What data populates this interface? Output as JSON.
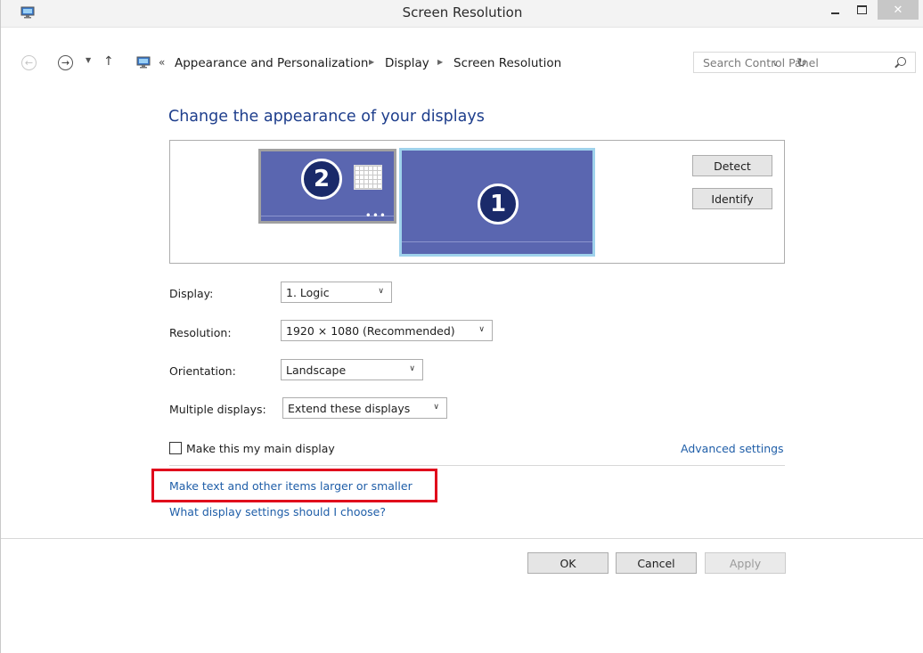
{
  "window": {
    "title": "Screen Resolution",
    "close_glyph": "✕"
  },
  "nav": {
    "back_glyph": "←",
    "forward_glyph": "→",
    "recent_glyph": "▼",
    "up_glyph": "↑",
    "breadcrumb_overflow": "«",
    "breadcrumbs": [
      "Appearance and Personalization",
      "Display",
      "Screen Resolution"
    ],
    "arrow_glyph": "▶",
    "dropdown_glyph": "∨",
    "refresh_glyph": "↻",
    "search_placeholder": "Search Control Panel"
  },
  "content": {
    "heading": "Change the appearance of your displays",
    "monitors": [
      {
        "number": "2",
        "dots": "•••"
      },
      {
        "number": "1"
      }
    ],
    "detect_label": "Detect",
    "identify_label": "Identify",
    "fields": [
      {
        "label": "Display:",
        "value": "1. Logic"
      },
      {
        "label": "Resolution:",
        "value": "1920 × 1080 (Recommended)"
      },
      {
        "label": "Orientation:",
        "value": "Landscape"
      },
      {
        "label": "Multiple displays:",
        "value": "Extend these displays"
      }
    ],
    "chevron_glyph": "∨",
    "main_display_label": "Make this my main display",
    "main_display_checked": false,
    "advanced_settings_link": "Advanced settings",
    "text_size_link": "Make text and other items larger or smaller",
    "help_link": "What display settings should I choose?"
  },
  "footer": {
    "ok_label": "OK",
    "cancel_label": "Cancel",
    "apply_label": "Apply"
  },
  "colors": {
    "link": "#1f5ea8",
    "heading": "#1e3e8c",
    "highlight": "#e0001b",
    "monitor_fill": "#5a66b0"
  }
}
